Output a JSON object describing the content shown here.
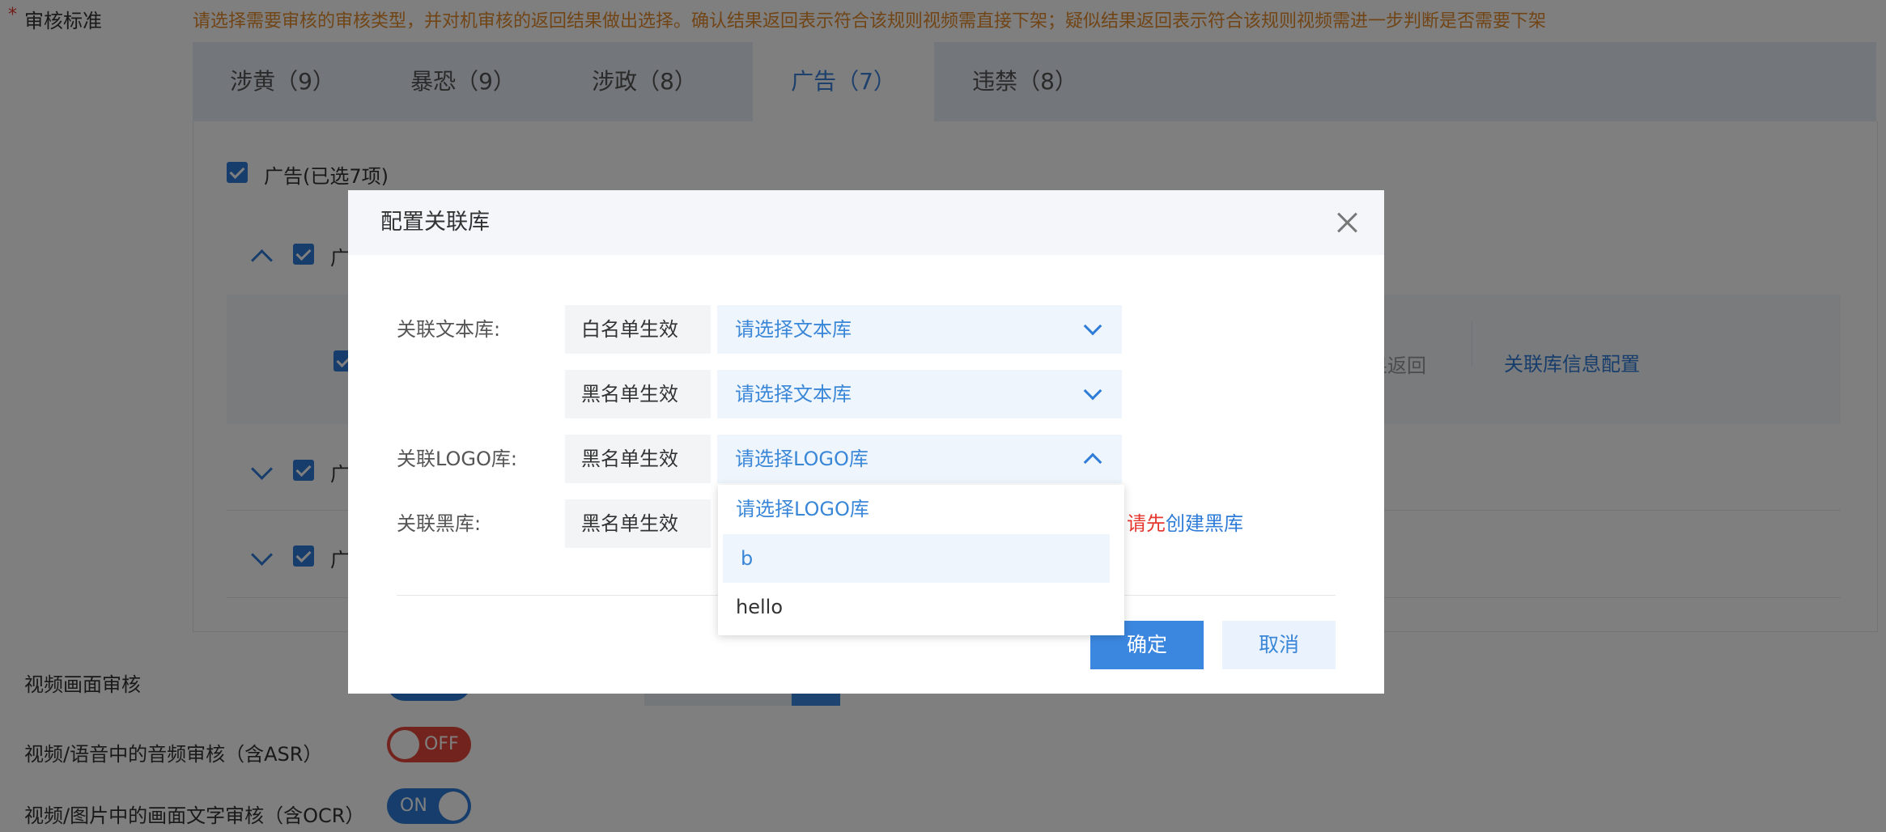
{
  "page": {
    "audit_standard_label": "审核标准",
    "required_mark": "*",
    "hint": "请选择需要审核的审核类型，并对机审核的返回结果做出选择。确认结果返回表示符合该规则视频需直接下架；疑似结果返回表示符合该规则视频需进一步判断是否需要下架",
    "tabs": [
      {
        "label": "涉黄（9）"
      },
      {
        "label": "暴恐（9）"
      },
      {
        "label": "涉政（8）"
      },
      {
        "label": "广告（7）"
      },
      {
        "label": "违禁（8）"
      }
    ],
    "ad_group_label": "广告(已选7项)",
    "sub_rows": [
      {
        "label": "广"
      },
      {
        "label": "广"
      },
      {
        "label": "广"
      }
    ],
    "result_return_partial": "果返回",
    "link_config": "关联库信息配置",
    "video_frame_audit": "视频画面审核",
    "asr_audit": "视频/语音中的音频审核（含ASR）",
    "ocr_audit": "视频/图片中的画面文字审核（含OCR）",
    "asr_switch": "OFF",
    "ocr_switch": "ON"
  },
  "modal": {
    "title": "配置关联库",
    "rows": {
      "text_lib_label": "关联文本库:",
      "logo_lib_label": "关联LOGO库:",
      "black_lib_label": "关联黑库:",
      "whitelist_mode": "白名单生效",
      "blacklist_mode": "黑名单生效",
      "text_select_placeholder": "请选择文本库",
      "logo_select_placeholder": "请选择LOGO库"
    },
    "logo_dropdown_options": [
      "请选择LOGO库",
      "b",
      "hello"
    ],
    "black_lib_warning_prefix": "请先",
    "black_lib_create_link": "创建黑库",
    "confirm": "确定",
    "cancel": "取消"
  }
}
